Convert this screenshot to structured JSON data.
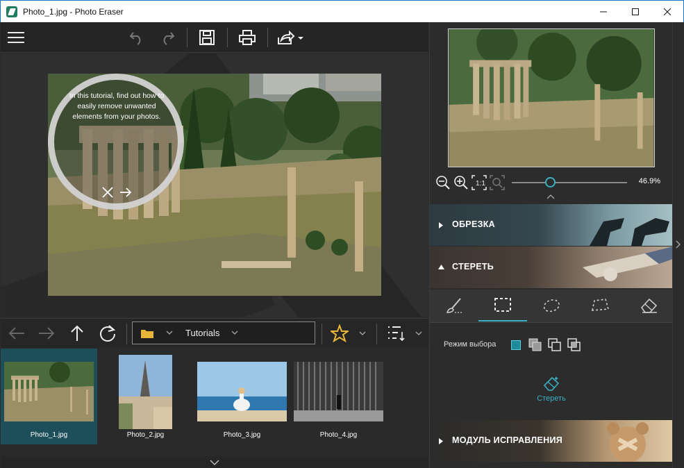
{
  "window": {
    "title": "Photo_1.jpg - Photo Eraser"
  },
  "toolbar": {
    "icons": [
      "menu-icon",
      "undo-icon",
      "redo-icon",
      "save-icon",
      "print-icon",
      "share-icon"
    ]
  },
  "tutorial": {
    "text": "In this tutorial, find out how to easily remove unwanted elements from your photos."
  },
  "navigation": {
    "folder": "Tutorials",
    "icons": [
      "back-icon",
      "forward-icon",
      "up-icon",
      "refresh-icon",
      "folder-icon",
      "star-icon",
      "sort-icon"
    ]
  },
  "thumbnails": [
    {
      "name": "Photo_1.jpg",
      "selected": true
    },
    {
      "name": "Photo_2.jpg",
      "selected": false
    },
    {
      "name": "Photo_3.jpg",
      "selected": false
    },
    {
      "name": "Photo_4.jpg",
      "selected": false
    }
  ],
  "zoom": {
    "value": "46.9%",
    "level": 0.469
  },
  "sections": {
    "crop": "ОБРЕЗКА",
    "erase": "СТЕРЕТЬ",
    "repair": "МОДУЛЬ ИСПРАВЛЕНИЯ"
  },
  "erase_panel": {
    "selection_mode_label": "Режим выбора",
    "erase_button": "Стереть"
  },
  "colors": {
    "accent": "#3bb0c2",
    "selected_thumb": "#1d4f5a"
  }
}
